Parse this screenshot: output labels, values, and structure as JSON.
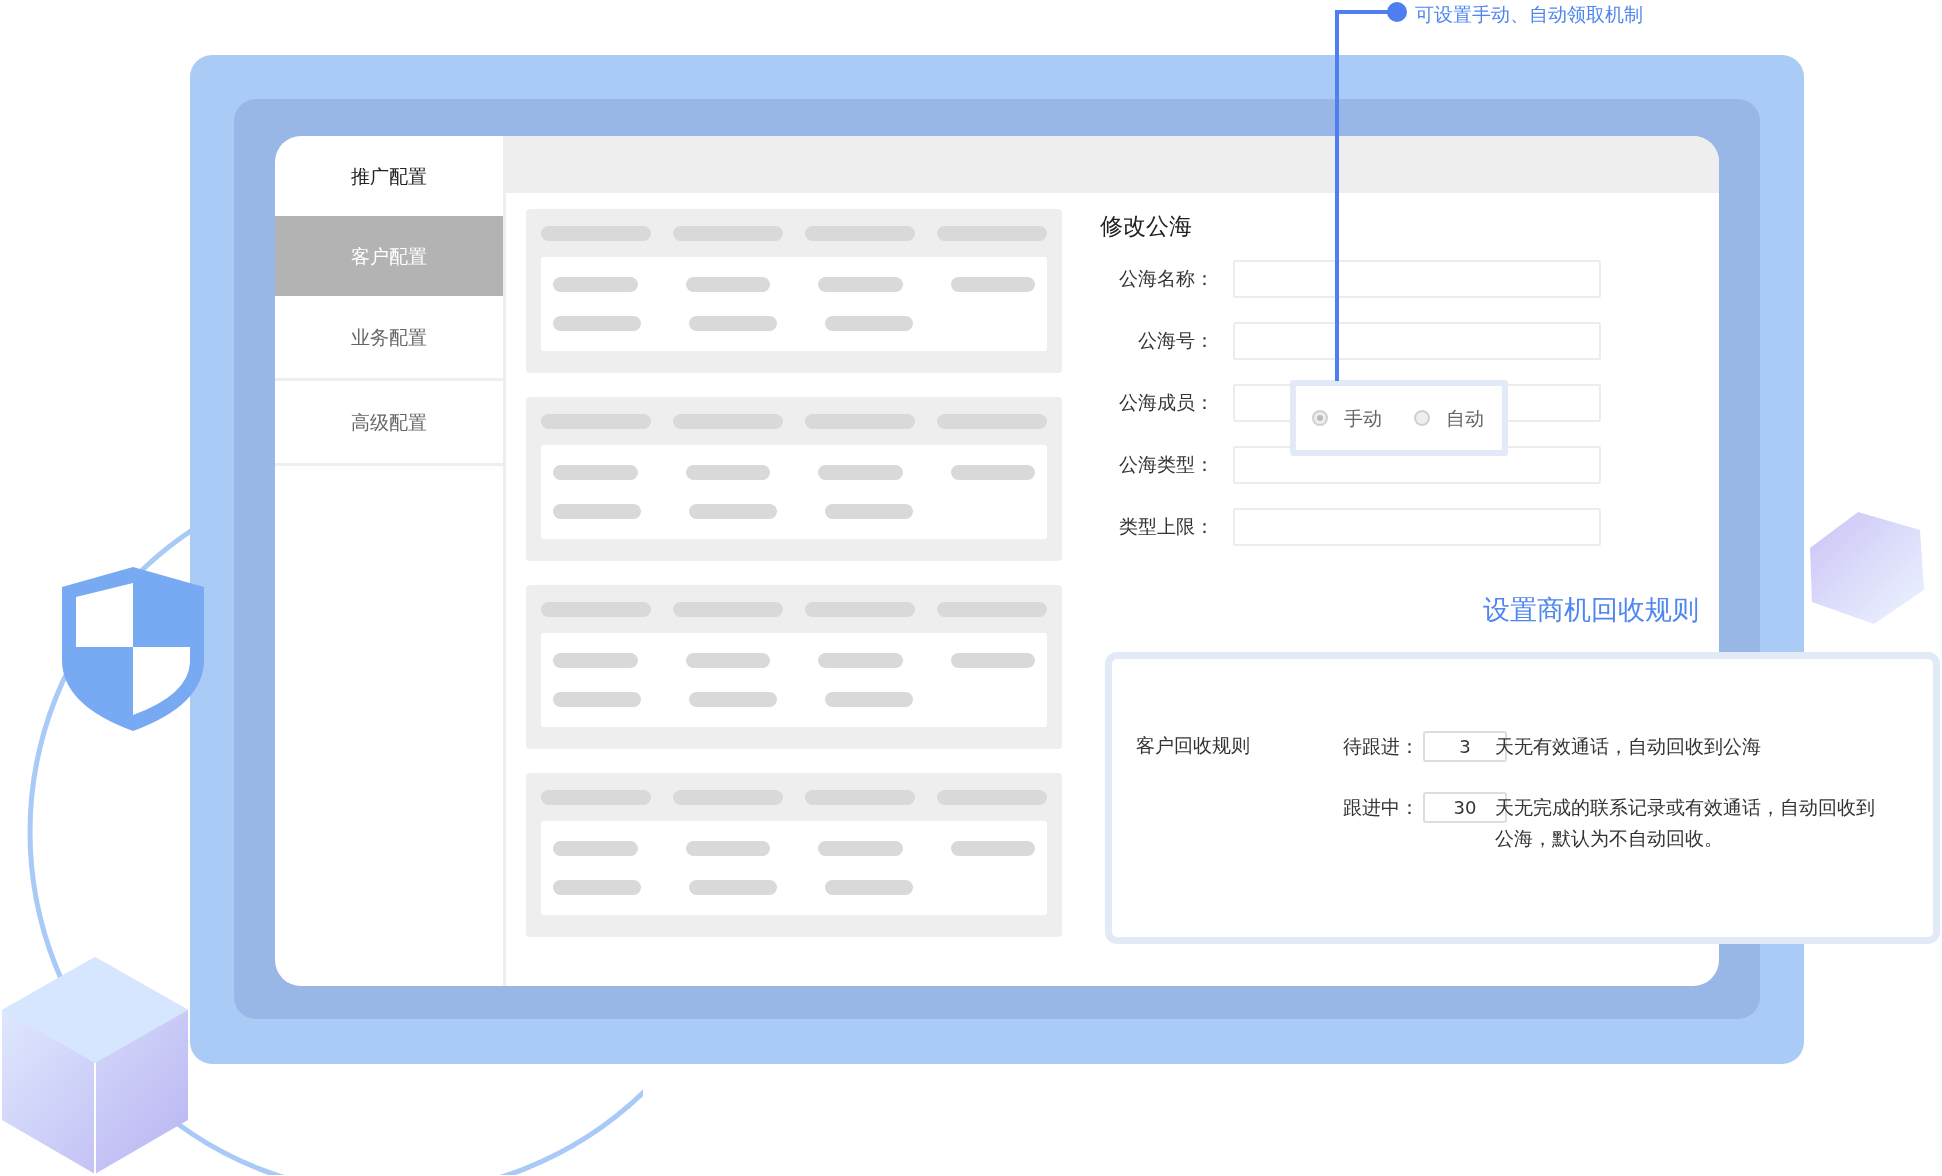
{
  "annotation": {
    "text": "可设置手动、自动领取机制"
  },
  "sidebar": {
    "items": [
      {
        "label": "推广配置",
        "selected": false
      },
      {
        "label": "客户配置",
        "selected": true
      },
      {
        "label": "业务配置",
        "selected": false
      },
      {
        "label": "高级配置",
        "selected": false
      }
    ]
  },
  "form": {
    "title": "修改公海",
    "fields": [
      {
        "label": "公海名称："
      },
      {
        "label": "公海号："
      },
      {
        "label": "公海成员："
      },
      {
        "label": "公海类型："
      },
      {
        "label": "类型上限："
      }
    ]
  },
  "member_popup": {
    "options": [
      {
        "label": "手动",
        "selected": true
      },
      {
        "label": "自动",
        "selected": false
      }
    ]
  },
  "rule_link": {
    "text": "设置商机回收规则"
  },
  "rules": {
    "title": "客户回收规则",
    "items": [
      {
        "label": "待跟进：",
        "value": "3",
        "text": "天无有效通话，自动回收到公海"
      },
      {
        "label": "跟进中：",
        "value": "30",
        "text": "天无完成的联系记录或有效通话，自动回收到公海，默认为不自动回收。"
      }
    ]
  }
}
